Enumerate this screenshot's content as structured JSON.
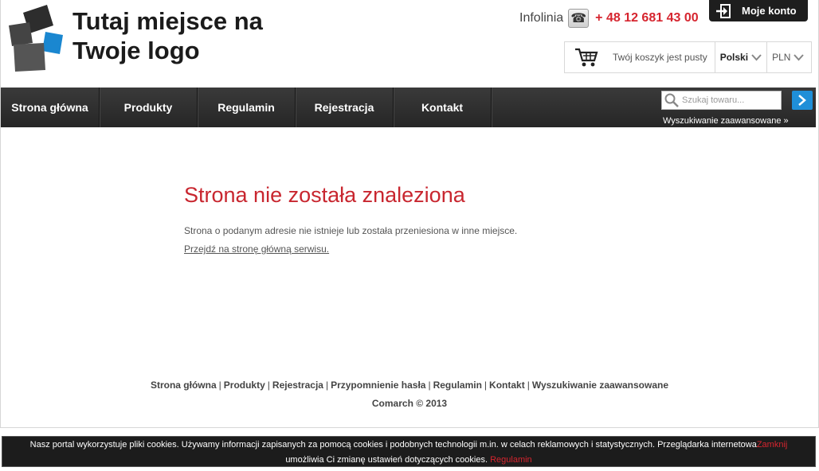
{
  "header": {
    "logo_line1": "Tutaj miejsce na",
    "logo_line2": "Twoje logo",
    "hotline_label": "Infolinia",
    "phone_number": "+ 48 12 681 43 00",
    "account_button": "Moje konto",
    "cart_text": "Twój koszyk jest pusty",
    "language": "Polski",
    "currency": "PLN"
  },
  "nav": {
    "items": [
      {
        "label": "Strona główna"
      },
      {
        "label": "Produkty"
      },
      {
        "label": "Regulamin"
      },
      {
        "label": "Rejestracja"
      },
      {
        "label": "Kontakt"
      }
    ],
    "search_placeholder": "Szukaj towaru...",
    "advanced_search": "Wyszukiwanie zaawansowane »"
  },
  "main": {
    "title": "Strona nie została znaleziona",
    "message": "Strona o podanym adresie nie istnieje lub została przeniesiona w inne miejsce.",
    "home_link": "Przejdź na stronę główną serwisu."
  },
  "footer": {
    "links": [
      {
        "label": "Strona główna"
      },
      {
        "label": "Produkty"
      },
      {
        "label": "Rejestracja"
      },
      {
        "label": "Przypomnienie hasła"
      },
      {
        "label": "Regulamin"
      },
      {
        "label": "Kontakt"
      },
      {
        "label": "Wyszukiwanie zaawansowane"
      }
    ],
    "separator": "|",
    "copyright": "Comarch © 2013"
  },
  "cookie": {
    "text_line1": "Nasz portal wykorzystuje pliki cookies. Używamy informacji zapisanych za pomocą cookies i podobnych technologii m.in. w celach reklamowych i statystycznych. Przeglądarka internetowa",
    "close_label": "Zamknij",
    "text_line2": "umożliwia Ci zmianę ustawień dotyczących cookies.",
    "rules_label": "Regulamin"
  },
  "colors": {
    "accent_red": "#d6252f",
    "search_blue": "#1f8fd8",
    "logo_blue": "#1a87d0",
    "nav_dark": "#2e2e2e"
  },
  "icons": [
    "logo-icon",
    "phone-icon",
    "login-icon",
    "cart-icon",
    "chevron-down-icon",
    "search-icon",
    "arrow-right-icon"
  ]
}
